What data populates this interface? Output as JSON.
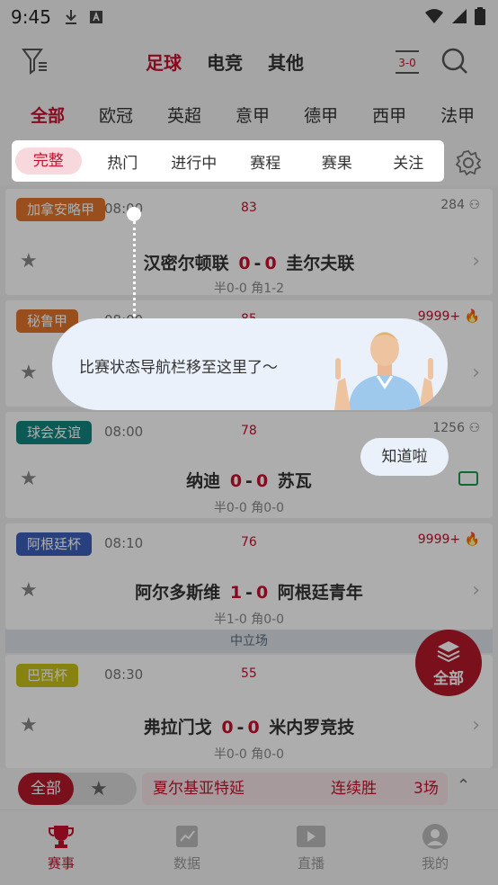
{
  "status": {
    "time": "9:45"
  },
  "topnav": {
    "tabs": [
      {
        "label": "足球",
        "active": true
      },
      {
        "label": "电竞",
        "active": false
      },
      {
        "label": "其他",
        "active": false
      }
    ],
    "score_icon_text": "3-0"
  },
  "leagues": [
    "全部",
    "欧冠",
    "英超",
    "意甲",
    "德甲",
    "西甲",
    "法甲"
  ],
  "filters": [
    "完整",
    "热门",
    "进行中",
    "赛程",
    "赛果",
    "关注"
  ],
  "matches": [
    {
      "league": "加拿安略甲",
      "league_color": "#e0752b",
      "time": "08:00",
      "minute": "83",
      "count": "284",
      "home": "汉密尔顿联",
      "home_score": "0",
      "away_score": "0",
      "away": "圭尔夫联",
      "sub": "半0-0 角1-2"
    },
    {
      "league": "秘鲁甲",
      "league_color": "#e0752b",
      "time": "08:00",
      "minute": "85",
      "count": "9999+"
    },
    {
      "league": "球会友谊",
      "league_color": "#11857f",
      "time": "08:00",
      "minute": "78",
      "count": "1256",
      "home": "纳迪",
      "home_score": "0",
      "away_score": "0",
      "away": "苏瓦",
      "sub": "半0-0 角0-0"
    },
    {
      "league": "阿根廷杯",
      "league_color": "#3c5fb8",
      "time": "08:10",
      "minute": "76",
      "count": "9999+",
      "home": "阿尔多斯维",
      "home_score": "1",
      "away_score": "0",
      "away": "阿根廷青年",
      "sub": "半1-0 角0-0"
    },
    {
      "league": "巴西杯",
      "league_color": "#c9c21a",
      "time": "08:30",
      "minute": "55",
      "home": "弗拉门戈",
      "home_score": "0",
      "away_score": "0",
      "away": "米内罗竞技",
      "sub": "半0-0 角0-0"
    }
  ],
  "neutral_label": "中立场",
  "fab_label": "全部",
  "bottombar": {
    "all_label": "全部",
    "team": "夏尔基亚特延",
    "streak_label": "连续胜",
    "streak_value": "3场"
  },
  "tabbar": [
    {
      "label": "赛事",
      "active": true
    },
    {
      "label": "数据",
      "active": false
    },
    {
      "label": "直播",
      "active": false
    },
    {
      "label": "我的",
      "active": false
    }
  ],
  "guide": {
    "message": "比赛状态导航栏移至这里了～",
    "button_label": "知道啦"
  },
  "accent_color": "#c8102e"
}
